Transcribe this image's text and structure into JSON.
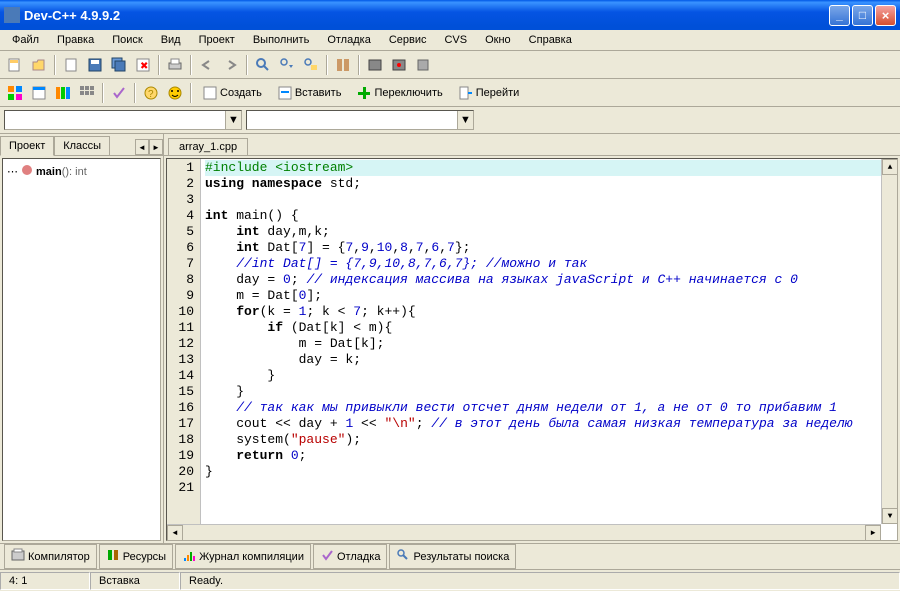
{
  "window": {
    "title": "Dev-C++ 4.9.9.2"
  },
  "menu": [
    "Файл",
    "Правка",
    "Поиск",
    "Вид",
    "Проект",
    "Выполнить",
    "Отладка",
    "Сервис",
    "CVS",
    "Окно",
    "Справка"
  ],
  "toolbar2": {
    "create": "Создать",
    "insert": "Вставить",
    "switch": "Переключить",
    "goto": "Перейти"
  },
  "sidebar": {
    "tabs": [
      "Проект",
      "Классы"
    ],
    "tree_item": {
      "name": "main",
      "sig": "(): int"
    }
  },
  "file_tab": "array_1.cpp",
  "code_lines": [
    {
      "n": 1,
      "tokens": [
        {
          "t": "#include <iostream>",
          "c": "pp"
        }
      ],
      "hl": true
    },
    {
      "n": 2,
      "tokens": [
        {
          "t": "using namespace",
          "c": "kw"
        },
        {
          "t": " std;",
          "c": ""
        }
      ]
    },
    {
      "n": 3,
      "tokens": []
    },
    {
      "n": 4,
      "tokens": [
        {
          "t": "int",
          "c": "kw"
        },
        {
          "t": " main() {",
          "c": ""
        }
      ]
    },
    {
      "n": 5,
      "tokens": [
        {
          "t": "    ",
          "c": ""
        },
        {
          "t": "int",
          "c": "kw"
        },
        {
          "t": " day,m,k;",
          "c": ""
        }
      ]
    },
    {
      "n": 6,
      "tokens": [
        {
          "t": "    ",
          "c": ""
        },
        {
          "t": "int",
          "c": "kw"
        },
        {
          "t": " Dat[",
          "c": ""
        },
        {
          "t": "7",
          "c": "num"
        },
        {
          "t": "] = {",
          "c": ""
        },
        {
          "t": "7",
          "c": "num"
        },
        {
          "t": ",",
          "c": ""
        },
        {
          "t": "9",
          "c": "num"
        },
        {
          "t": ",",
          "c": ""
        },
        {
          "t": "10",
          "c": "num"
        },
        {
          "t": ",",
          "c": ""
        },
        {
          "t": "8",
          "c": "num"
        },
        {
          "t": ",",
          "c": ""
        },
        {
          "t": "7",
          "c": "num"
        },
        {
          "t": ",",
          "c": ""
        },
        {
          "t": "6",
          "c": "num"
        },
        {
          "t": ",",
          "c": ""
        },
        {
          "t": "7",
          "c": "num"
        },
        {
          "t": "};",
          "c": ""
        }
      ]
    },
    {
      "n": 7,
      "tokens": [
        {
          "t": "    ",
          "c": ""
        },
        {
          "t": "//int Dat[] = {7,9,10,8,7,6,7}; //можно и так",
          "c": "cmt"
        }
      ]
    },
    {
      "n": 8,
      "tokens": [
        {
          "t": "    day = ",
          "c": ""
        },
        {
          "t": "0",
          "c": "num"
        },
        {
          "t": "; ",
          "c": ""
        },
        {
          "t": "// индексация массива на языках javaScript и C++ начинается с 0",
          "c": "cmt"
        }
      ]
    },
    {
      "n": 9,
      "tokens": [
        {
          "t": "    m = Dat[",
          "c": ""
        },
        {
          "t": "0",
          "c": "num"
        },
        {
          "t": "];",
          "c": ""
        }
      ]
    },
    {
      "n": 10,
      "tokens": [
        {
          "t": "    ",
          "c": ""
        },
        {
          "t": "for",
          "c": "kw"
        },
        {
          "t": "(k = ",
          "c": ""
        },
        {
          "t": "1",
          "c": "num"
        },
        {
          "t": "; k < ",
          "c": ""
        },
        {
          "t": "7",
          "c": "num"
        },
        {
          "t": "; k++){",
          "c": ""
        }
      ]
    },
    {
      "n": 11,
      "tokens": [
        {
          "t": "        ",
          "c": ""
        },
        {
          "t": "if",
          "c": "kw"
        },
        {
          "t": " (Dat[k] < m){",
          "c": ""
        }
      ]
    },
    {
      "n": 12,
      "tokens": [
        {
          "t": "            m = Dat[k];",
          "c": ""
        }
      ]
    },
    {
      "n": 13,
      "tokens": [
        {
          "t": "            day = k;",
          "c": ""
        }
      ]
    },
    {
      "n": 14,
      "tokens": [
        {
          "t": "        }",
          "c": ""
        }
      ]
    },
    {
      "n": 15,
      "tokens": [
        {
          "t": "    }",
          "c": ""
        }
      ]
    },
    {
      "n": 16,
      "tokens": [
        {
          "t": "    ",
          "c": ""
        },
        {
          "t": "// так как мы привыкли вести отсчет дням недели от 1, а не от 0 то прибавим 1",
          "c": "cmt"
        }
      ]
    },
    {
      "n": 17,
      "tokens": [
        {
          "t": "    cout << day + ",
          "c": ""
        },
        {
          "t": "1",
          "c": "num"
        },
        {
          "t": " << ",
          "c": ""
        },
        {
          "t": "\"\\n\"",
          "c": "str"
        },
        {
          "t": "; ",
          "c": ""
        },
        {
          "t": "// в этот день была самая низкая температура за неделю",
          "c": "cmt"
        }
      ]
    },
    {
      "n": 18,
      "tokens": [
        {
          "t": "    system(",
          "c": ""
        },
        {
          "t": "\"pause\"",
          "c": "str"
        },
        {
          "t": ");",
          "c": ""
        }
      ]
    },
    {
      "n": 19,
      "tokens": [
        {
          "t": "    ",
          "c": ""
        },
        {
          "t": "return",
          "c": "kw"
        },
        {
          "t": " ",
          "c": ""
        },
        {
          "t": "0",
          "c": "num"
        },
        {
          "t": ";",
          "c": ""
        }
      ]
    },
    {
      "n": 20,
      "tokens": [
        {
          "t": "}",
          "c": ""
        }
      ]
    },
    {
      "n": 21,
      "tokens": []
    }
  ],
  "bottom_tabs": [
    "Компилятор",
    "Ресурсы",
    "Журнал компиляции",
    "Отладка",
    "Результаты поиска"
  ],
  "status": {
    "pos": "4: 1",
    "mode": "Вставка",
    "state": "Ready."
  }
}
